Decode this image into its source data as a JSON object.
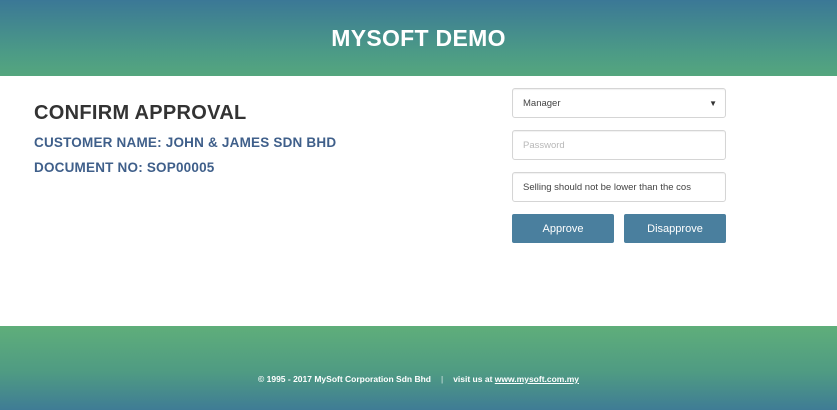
{
  "header": {
    "title": "MYSOFT DEMO"
  },
  "info": {
    "heading": "CONFIRM APPROVAL",
    "customer_line": "CUSTOMER NAME: JOHN & JAMES SDN BHD",
    "document_line": "DOCUMENT NO: SOP00005"
  },
  "form": {
    "role_select_value": "Manager",
    "password_placeholder": "Password",
    "remark_value": "Selling should not be lower than the cos",
    "approve_label": "Approve",
    "disapprove_label": "Disapprove"
  },
  "footer": {
    "copyright": "© 1995 - 2017 MySoft Corporation Sdn Bhd",
    "separator": "|",
    "visit_prefix": "visit us at",
    "link_text": "www.mysoft.com.my"
  },
  "colors": {
    "header_gradient_top": "#3b7896",
    "header_gradient_bottom": "#55a67e",
    "button_bg": "#4a7f9e",
    "info_text": "#3f5f8a"
  }
}
